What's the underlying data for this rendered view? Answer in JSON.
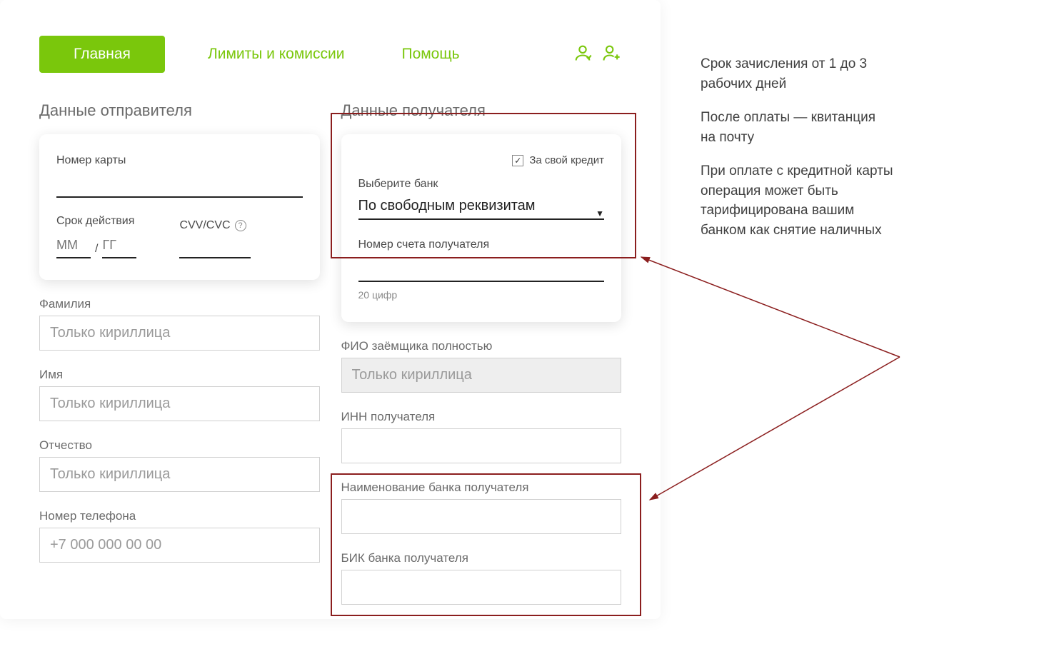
{
  "colors": {
    "accent": "#7ac70c",
    "highlight": "#8b1e1e"
  },
  "nav": {
    "home": "Главная",
    "limits": "Лимиты и комиссии",
    "help": "Помощь"
  },
  "sender": {
    "section_title": "Данные отправителя",
    "card_number_label": "Номер карты",
    "expiry_label": "Срок действия",
    "mm_placeholder": "ММ",
    "yy_placeholder": "ГГ",
    "cvv_label": "CVV/CVC",
    "surname_label": "Фамилия",
    "name_label": "Имя",
    "patronymic_label": "Отчество",
    "cyrillic_placeholder": "Только кириллица",
    "phone_label": "Номер телефона",
    "phone_placeholder": "+7 000 000 00 00"
  },
  "recipient": {
    "section_title": "Данные получателя",
    "own_credit_label": "За свой кредит",
    "bank_select_label": "Выберите банк",
    "bank_select_value": "По свободным реквизитам",
    "account_label": "Номер счета получателя",
    "account_hint": "20 цифр",
    "fio_label": "ФИО заёмщика полностью",
    "fio_placeholder": "Только кириллица",
    "inn_label": "ИНН получателя",
    "bank_name_label": "Наименование банка получателя",
    "bik_label": "БИК банка получателя"
  },
  "side": {
    "p1": "Срок зачисления от 1 до 3 рабочих дней",
    "p2": "После оплаты — квитанция на почту",
    "p3": "При оплате с кредитной карты операция может быть тарифицирована вашим банком как снятие наличных"
  }
}
